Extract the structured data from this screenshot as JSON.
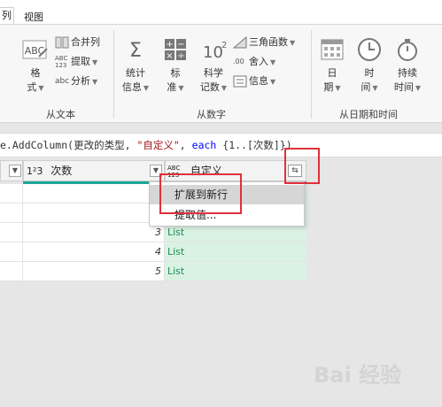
{
  "tabs": {
    "active_label": "列",
    "view_label": "视图"
  },
  "ribbon": {
    "text_group": {
      "label": "从文本",
      "format": {
        "label": "格",
        "label2": "式"
      },
      "merge": "合并列",
      "extract": "提取",
      "parse": "分析"
    },
    "number_group": {
      "label": "从数字",
      "statistics": {
        "label": "统计",
        "label2": "信息"
      },
      "standard": {
        "label": "标",
        "label2": "准"
      },
      "scientific": {
        "label": "科学",
        "label2": "记数"
      },
      "trig": "三角函数",
      "rounding": "舍入",
      "info": "信息"
    },
    "datetime_group": {
      "label": "从日期和时间",
      "date": {
        "label": "日",
        "label2": "期"
      },
      "time": {
        "label": "时",
        "label2": "间"
      },
      "duration": {
        "label": "持续",
        "label2": "时间"
      }
    }
  },
  "formula": {
    "prefix": "e.AddColumn(更改的类型, ",
    "string": "\"自定义\"",
    "sep": ", ",
    "keyword": "each",
    "suffix": " {1..[次数]})"
  },
  "grid": {
    "col_index_type": "1²3",
    "col_count_header": "次数",
    "col_custom_type": "ABC 123",
    "col_custom_header": "自定义",
    "rows": [
      {
        "count": "",
        "value": ""
      },
      {
        "count": "",
        "value": ""
      },
      {
        "count": "3",
        "value": "List"
      },
      {
        "count": "4",
        "value": "List"
      },
      {
        "count": "5",
        "value": "List"
      }
    ]
  },
  "menu": {
    "expand_rows": "扩展到新行",
    "extract_values": "提取值..."
  },
  "watermark": "Bai 经验"
}
